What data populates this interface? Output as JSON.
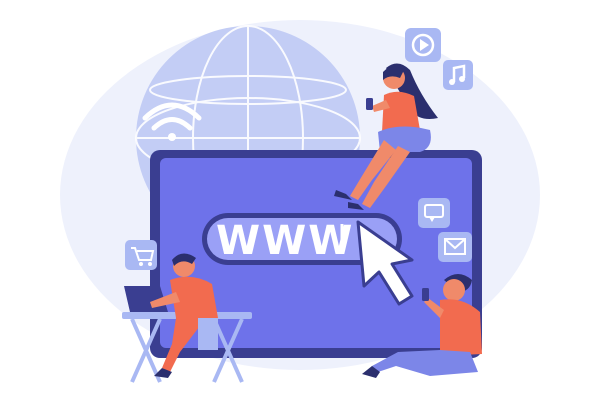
{
  "illustration": {
    "address_bar_text": "WWW",
    "icons": [
      "globe-icon",
      "wifi-icon",
      "play-icon",
      "music-note-icon",
      "chat-bubble-icon",
      "mail-icon",
      "shopping-cart-icon",
      "cursor-arrow-icon"
    ],
    "colors": {
      "background_blob": "#e8ecfb",
      "globe": "#b9c6f4",
      "monitor_frame": "#3b3f8f",
      "screen": "#6b6fe8",
      "address_bar": "#8f95f5",
      "address_text": "#ffffff",
      "skin": "#f08a6a",
      "shirt": "#f26b4f",
      "pants": "#7c86e8",
      "hair": "#2b2f6e",
      "icon_tile": "#9fb0f0"
    }
  }
}
